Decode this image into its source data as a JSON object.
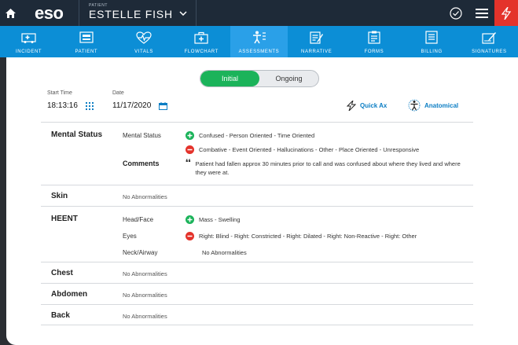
{
  "topbar": {
    "logo": "eso",
    "patient_tag": "PATIENT",
    "patient_name": "ESTELLE FISH"
  },
  "nav": [
    {
      "label": "INCIDENT",
      "icon": "ambulance-icon"
    },
    {
      "label": "PATIENT",
      "icon": "id-card-icon"
    },
    {
      "label": "VITALS",
      "icon": "heart-pulse-icon"
    },
    {
      "label": "FLOWCHART",
      "icon": "medkit-icon"
    },
    {
      "label": "ASSESSMENTS",
      "icon": "body-assessment-icon"
    },
    {
      "label": "NARRATIVE",
      "icon": "notepad-pen-icon"
    },
    {
      "label": "FORMS",
      "icon": "clipboard-icon"
    },
    {
      "label": "BILLING",
      "icon": "invoice-icon"
    },
    {
      "label": "SIGNATURES",
      "icon": "signature-icon"
    }
  ],
  "active_nav": "ASSESSMENTS",
  "toggle": {
    "initial": "Initial",
    "ongoing": "Ongoing",
    "selected": "Initial"
  },
  "start_time": {
    "label": "Start Time",
    "value": "18:13:16"
  },
  "date": {
    "label": "Date",
    "value": "11/17/2020"
  },
  "quick_ax": "Quick Ax",
  "anatomical": "Anatomical",
  "sections": {
    "mental_status": {
      "title": "Mental Status",
      "sub": "Mental Status",
      "positive": "Confused - Person Oriented - Time Oriented",
      "negative": "Combative - Event Oriented - Hallucinations - Other - Place Oriented - Unresponsive",
      "comments_label": "Comments",
      "comment": "Patient had fallen approx 30 minutes prior to call and was confused about where they lived and where they were at."
    },
    "skin": {
      "title": "Skin",
      "value": "No Abnormalities"
    },
    "heent": {
      "title": "HEENT",
      "head_label": "Head/Face",
      "head_positive": "Mass - Swelling",
      "eyes_label": "Eyes",
      "eyes_negative": "Right: Blind - Right: Constricted - Right: Dilated - Right: Non-Reactive - Right: Other",
      "neck_label": "Neck/Airway",
      "neck_value": "No Abnormalities"
    },
    "chest": {
      "title": "Chest",
      "value": "No Abnormalities"
    },
    "abdomen": {
      "title": "Abdomen",
      "value": "No Abnormalities"
    },
    "back": {
      "title": "Back",
      "value": "No Abnormalities"
    }
  },
  "colors": {
    "nav": "#0c8ed6",
    "topbar": "#1e2a38",
    "positive": "#1bb35a",
    "negative": "#e4332b",
    "link": "#0c7ec4"
  }
}
